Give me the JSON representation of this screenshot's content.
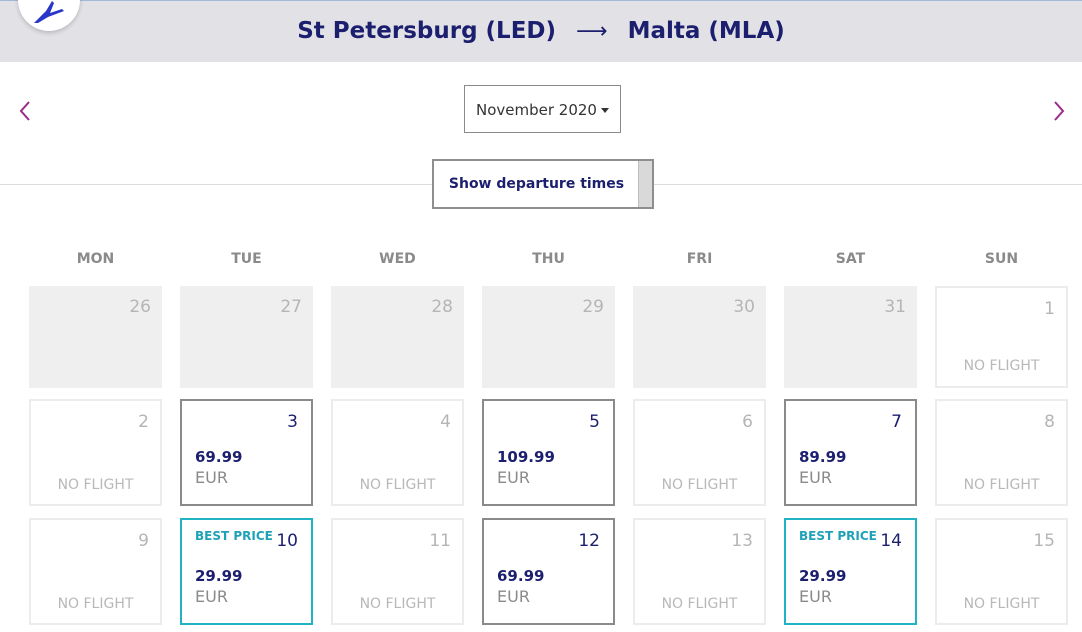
{
  "header": {
    "origin": "St Petersburg (LED)",
    "arrow": "⟶",
    "destination": "Malta (MLA)"
  },
  "nav": {
    "prev_icon": "chevron-left-icon",
    "next_icon": "chevron-right-icon"
  },
  "month_select": {
    "value": "November 2020"
  },
  "show_times_label": "Show departure times",
  "weekdays": [
    "MON",
    "TUE",
    "WED",
    "THU",
    "FRI",
    "SAT",
    "SUN"
  ],
  "weeks": [
    [
      {
        "day": "26",
        "state": "past"
      },
      {
        "day": "27",
        "state": "past"
      },
      {
        "day": "28",
        "state": "past"
      },
      {
        "day": "29",
        "state": "past"
      },
      {
        "day": "30",
        "state": "past"
      },
      {
        "day": "31",
        "state": "past"
      },
      {
        "day": "1",
        "state": "noflight",
        "label": "NO FLIGHT"
      }
    ],
    [
      {
        "day": "2",
        "state": "noflight",
        "label": "NO FLIGHT"
      },
      {
        "day": "3",
        "state": "avail",
        "price": "69.99",
        "currency": "EUR"
      },
      {
        "day": "4",
        "state": "noflight",
        "label": "NO FLIGHT"
      },
      {
        "day": "5",
        "state": "avail",
        "price": "109.99",
        "currency": "EUR"
      },
      {
        "day": "6",
        "state": "noflight",
        "label": "NO FLIGHT"
      },
      {
        "day": "7",
        "state": "avail",
        "price": "89.99",
        "currency": "EUR"
      },
      {
        "day": "8",
        "state": "noflight",
        "label": "NO FLIGHT"
      }
    ],
    [
      {
        "day": "9",
        "state": "noflight",
        "label": "NO FLIGHT"
      },
      {
        "day": "10",
        "state": "best",
        "badge": "BEST PRICE",
        "price": "29.99",
        "currency": "EUR"
      },
      {
        "day": "11",
        "state": "noflight",
        "label": "NO FLIGHT"
      },
      {
        "day": "12",
        "state": "avail",
        "price": "69.99",
        "currency": "EUR"
      },
      {
        "day": "13",
        "state": "noflight",
        "label": "NO FLIGHT"
      },
      {
        "day": "14",
        "state": "best",
        "badge": "BEST PRICE",
        "price": "29.99",
        "currency": "EUR"
      },
      {
        "day": "15",
        "state": "noflight",
        "label": "NO FLIGHT"
      }
    ]
  ],
  "colors": {
    "brand_navy": "#1b1f6e",
    "accent_magenta": "#9b2a8a",
    "best_price_teal": "#1fb3c4",
    "header_bg": "#e2e2e6"
  }
}
